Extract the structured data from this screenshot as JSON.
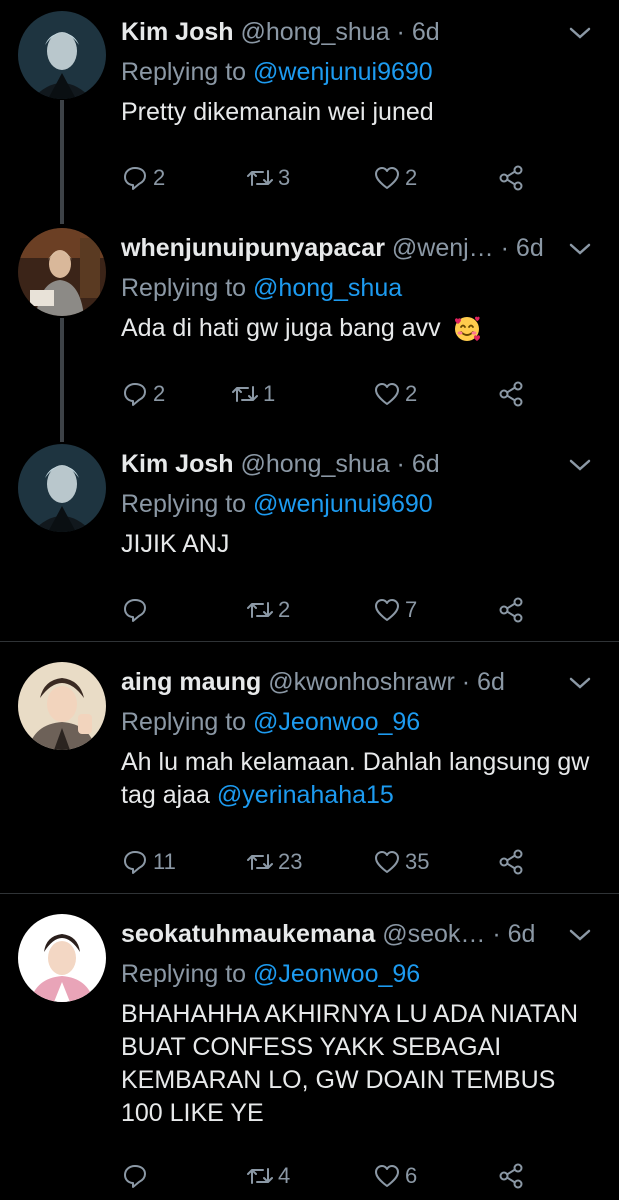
{
  "colors": {
    "background": "#000000",
    "link": "#1d9bf0",
    "muted": "#8b98a5",
    "text": "#e7e9ea",
    "divider": "#2f3336"
  },
  "tweets": [
    {
      "name": "Kim Josh",
      "handle": "@hong_shua",
      "dot": "·",
      "time": "6d",
      "reply_prefix": "Replying to",
      "reply_to": "@wenjunui9690",
      "text": "Pretty dikemanain wei juned",
      "text_mention": "",
      "replies": "2",
      "retweets": "3",
      "likes": "2"
    },
    {
      "name": "whenjunuipunyapacar",
      "handle": "@wenj…",
      "dot": "·",
      "time": "6d",
      "reply_prefix": "Replying to",
      "reply_to": "@hong_shua",
      "text": "Ada di hati gw juga bang avv",
      "text_mention": "",
      "emoji": "smiling-face-with-hearts",
      "replies": "2",
      "retweets": "1",
      "likes": "2"
    },
    {
      "name": "Kim Josh",
      "handle": "@hong_shua",
      "dot": "·",
      "time": "6d",
      "reply_prefix": "Replying to",
      "reply_to": "@wenjunui9690",
      "text": "JIJIK ANJ",
      "text_mention": "",
      "replies": "",
      "retweets": "2",
      "likes": "7"
    },
    {
      "name": "aing maung",
      "handle": "@kwonhoshrawr",
      "dot": "·",
      "time": "6d",
      "reply_prefix": "Replying to",
      "reply_to": "@Jeonwoo_96",
      "text": "Ah lu mah kelamaan. Dahlah langsung gw tag ajaa",
      "text_mention": "@yerinahaha15",
      "replies": "11",
      "retweets": "23",
      "likes": "35"
    },
    {
      "name": "seokatuhmaukemana",
      "handle": "@seok…",
      "dot": "·",
      "time": "6d",
      "reply_prefix": "Replying to",
      "reply_to": "@Jeonwoo_96",
      "text": "BHAHAHHA AKHIRNYA LU ADA NIATAN BUAT CONFESS YAKK SEBAGAI KEMBARAN LO, GW DOAIN TEMBUS 100 LIKE YE",
      "text_mention": "",
      "replies": "",
      "retweets": "4",
      "likes": "6"
    }
  ]
}
